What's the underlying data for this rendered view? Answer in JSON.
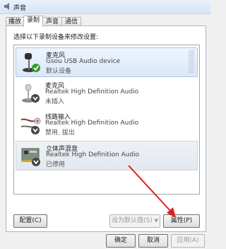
{
  "window": {
    "title": "声音"
  },
  "tabs": [
    {
      "label": "播放"
    },
    {
      "label": "录制"
    },
    {
      "label": "声音"
    },
    {
      "label": "通信"
    }
  ],
  "instruction": "选择以下录制设备来修改设置:",
  "devices": [
    {
      "name": "麦克风",
      "description": "Gsou USB Audio device",
      "status": "默认设备",
      "icon": "microphone-icon"
    },
    {
      "name": "麦克风",
      "description": "Realtek High Definition Audio",
      "status": "未插入",
      "icon": "microphone-icon"
    },
    {
      "name": "线路输入",
      "description": "Realtek High Definition Audio",
      "status": "禁用, 拔出",
      "icon": "line-in-icon"
    },
    {
      "name": "立体声混音",
      "description": "Realtek High Definition Audio",
      "status": "已停用",
      "icon": "sound-card-icon"
    }
  ],
  "buttons": {
    "configure": "配置(C)",
    "set_default": "设为默认值(S)",
    "properties": "属性(P)",
    "ok": "确定",
    "cancel": "取消",
    "apply": "应用(A)"
  },
  "colors": {
    "annotation_arrow": "#e0201c",
    "default_badge": "#2f9e2f",
    "down_badge": "#444444"
  }
}
